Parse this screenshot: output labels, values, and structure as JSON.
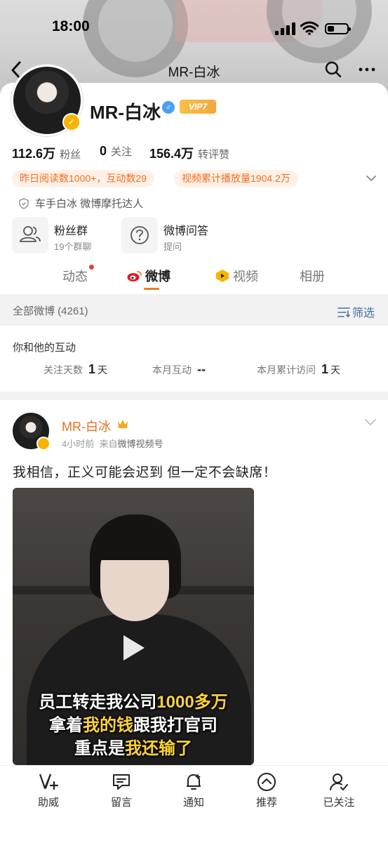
{
  "status": {
    "time": "18:00"
  },
  "nav": {
    "title": "MR-白冰"
  },
  "profile": {
    "name": "MR-白冰",
    "gender_symbol": "♂",
    "vip_label": "VIP7",
    "verified_mark": "✓",
    "stats": [
      {
        "value": "112.6万",
        "label": "粉丝"
      },
      {
        "value": "0",
        "label": "关注"
      },
      {
        "value": "156.4万",
        "label": "转评赞"
      }
    ],
    "tags": [
      "昨日阅读数1000+，互动数29",
      "视频累计播放量1904.2万"
    ],
    "certification": "车手白冰 微博摩托达人",
    "features": [
      {
        "title": "粉丝群",
        "subtitle": "19个群聊"
      },
      {
        "title": "微博问答",
        "subtitle": "提问"
      }
    ]
  },
  "tabs": [
    {
      "label": "动态",
      "active": false,
      "has_dot": true
    },
    {
      "label": "微博",
      "active": true
    },
    {
      "label": "视频",
      "active": false
    },
    {
      "label": "相册",
      "active": false
    }
  ],
  "filterbar": {
    "all_label": "全部微博 (4261)",
    "filter_label": "筛选"
  },
  "interaction": {
    "heading": "你和他的互动",
    "items": [
      {
        "label": "关注天数",
        "value": "1",
        "unit": "天"
      },
      {
        "label": "本月互动",
        "value": "--",
        "unit": ""
      },
      {
        "label": "本月累计访问",
        "value": "1",
        "unit": "天"
      }
    ]
  },
  "post": {
    "author": "MR-白冰",
    "time": "4小时前",
    "source_prefix": "来自",
    "source": "微博视频号",
    "text": "我相信，正义可能会迟到 但一定不会缺席！",
    "video_caption": {
      "line1_a": "员工转走我公司",
      "line1_b": "1000多万",
      "line2_a": "拿着",
      "line2_b": "我的钱",
      "line2_c": "跟我打官司",
      "line3_a": "重点是",
      "line3_b": "我还输了"
    }
  },
  "bottombar": {
    "items": [
      {
        "label": "助威",
        "icon": "cheer-icon"
      },
      {
        "label": "留言",
        "icon": "message-icon"
      },
      {
        "label": "通知",
        "icon": "bell-icon"
      },
      {
        "label": "推荐",
        "icon": "recommend-icon"
      },
      {
        "label": "已关注",
        "icon": "followed-icon"
      }
    ]
  },
  "colors": {
    "accent": "#f06f1f",
    "link": "#4a6fa0",
    "tag_bg": "#fff1e8"
  }
}
